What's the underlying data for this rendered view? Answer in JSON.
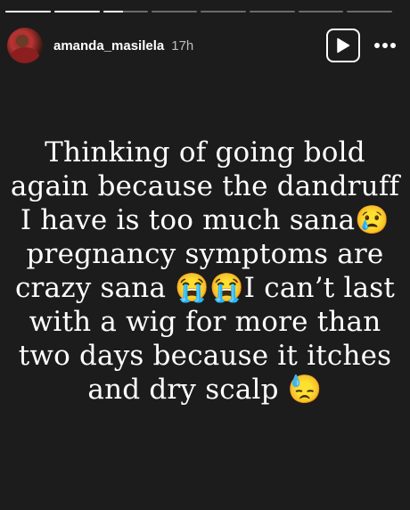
{
  "story": {
    "progress": {
      "total_segments": 8,
      "completed_segments": 2,
      "current_segment_fraction": 0.45
    },
    "author": {
      "username": "amanda_masilela",
      "posted_ago": "17h"
    },
    "controls": {
      "play_icon": "play-icon",
      "more_icon": "more-options-icon"
    },
    "caption": "Thinking of going bold again because the dandruff I have is too much sana😢 pregnancy symptoms are crazy sana 😭😭I can’t last with a wig for more than two days because it itches and dry scalp 😓"
  },
  "colors": {
    "background": "#1c1c1c",
    "text": "#ffffff",
    "muted": "#bdbdbd"
  }
}
